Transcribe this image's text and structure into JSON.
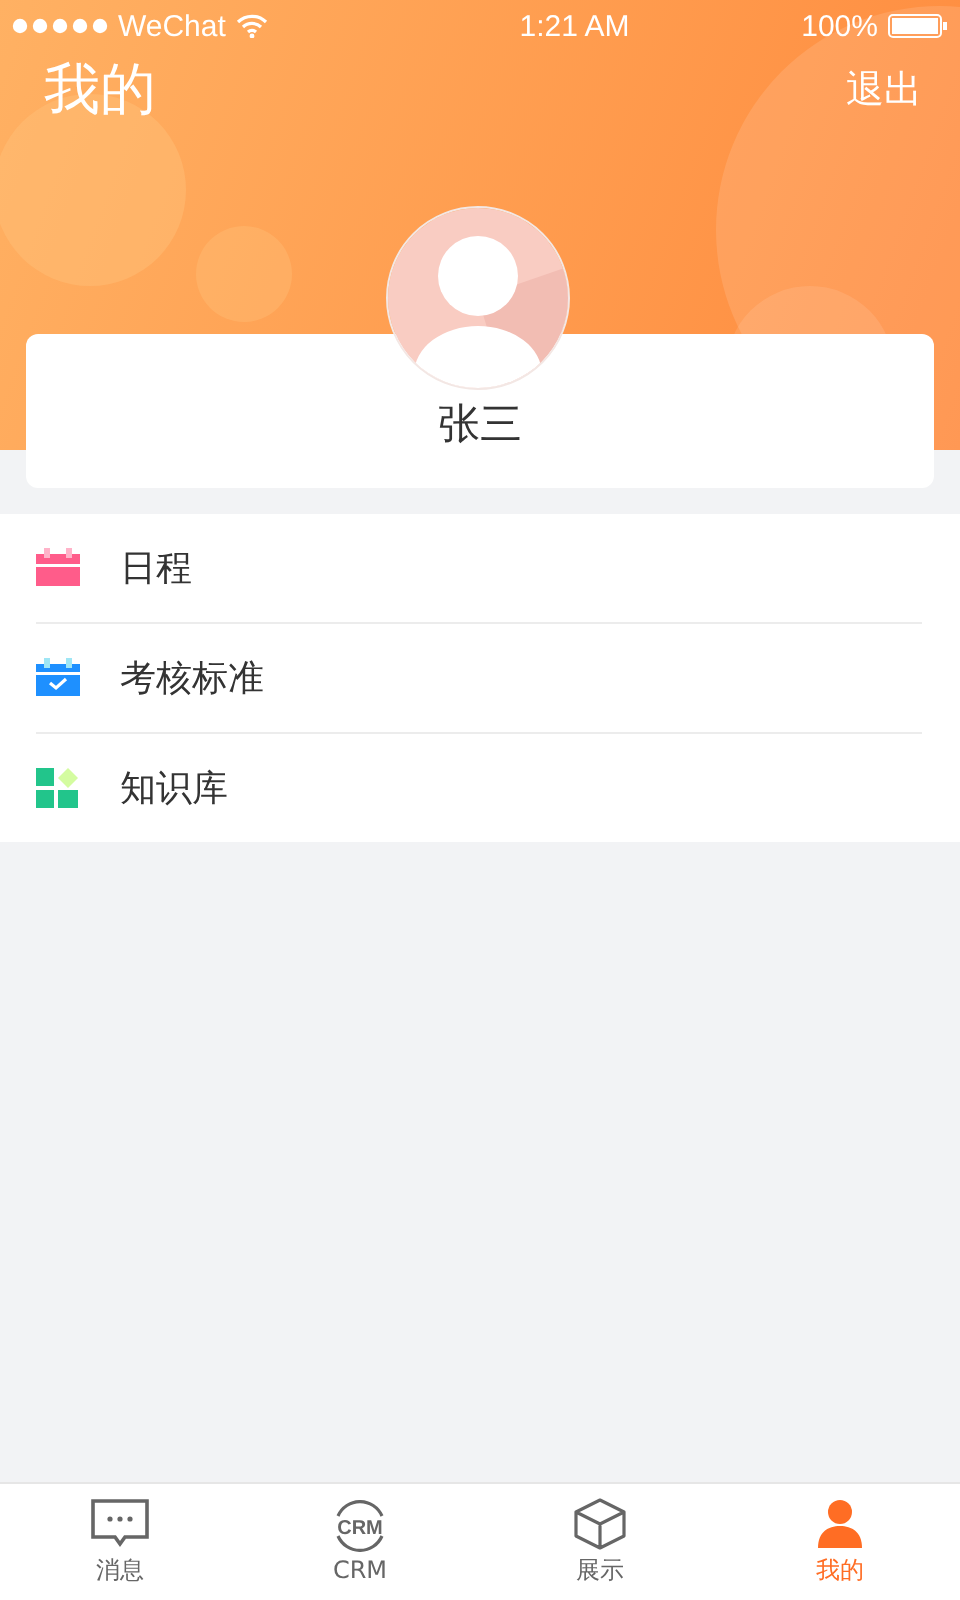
{
  "status_bar": {
    "carrier": "WeChat",
    "time": "1:21 AM",
    "battery": "100%"
  },
  "header": {
    "title": "我的",
    "logout": "退出"
  },
  "profile": {
    "name": "张三"
  },
  "menu": [
    {
      "kind": "calendar",
      "label": "日程"
    },
    {
      "kind": "check-calendar",
      "label": "考核标准"
    },
    {
      "kind": "grid",
      "label": "知识库"
    }
  ],
  "tabs": [
    {
      "kind": "chat",
      "label": "消息",
      "selected": false
    },
    {
      "kind": "crm",
      "label": "CRM",
      "icon_text": "CRM",
      "selected": false
    },
    {
      "kind": "box",
      "label": "展示",
      "selected": false
    },
    {
      "kind": "person",
      "label": "我的",
      "selected": true
    }
  ]
}
